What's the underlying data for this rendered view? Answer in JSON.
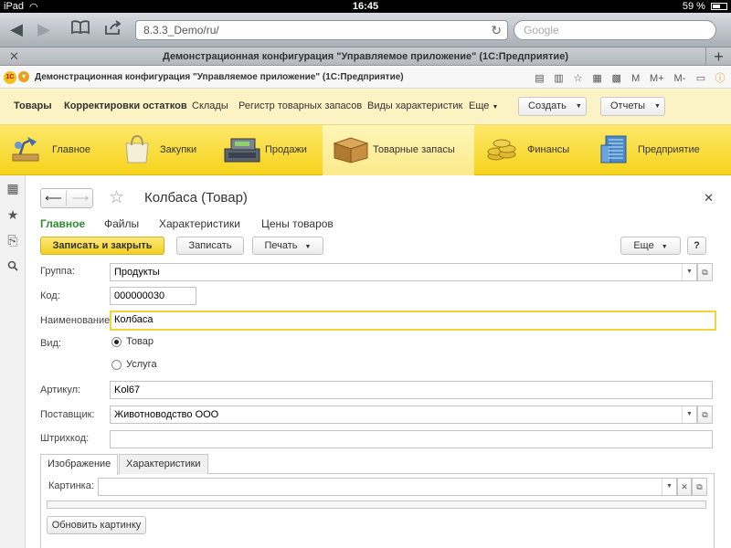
{
  "ios_status": {
    "device": "iPad",
    "time": "16:45",
    "battery": "59 %",
    "battery_level": 0.59
  },
  "browser": {
    "url": "8.3.3_Demo/ru/",
    "search_placeholder": "Google",
    "tab_title": "Демонстрационная конфигурация \"Управляемое приложение\" (1С:Предприятие)"
  },
  "app": {
    "title": "Демонстрационная конфигурация \"Управляемое приложение\"  (1С:Предприятие)",
    "toolbar_letters": {
      "m": "M",
      "m_plus": "M+",
      "m_minus": "M-"
    }
  },
  "section_menu": {
    "items": [
      "Товары",
      "Корректировки остатков",
      "Склады",
      "Регистр товарных запасов",
      "Виды характеристик"
    ],
    "more_label": "Еще",
    "create_label": "Создать",
    "reports_label": "Отчеты"
  },
  "sections": [
    {
      "label": "Главное",
      "icon": "desk-lamp-icon"
    },
    {
      "label": "Закупки",
      "icon": "shopping-bag-icon"
    },
    {
      "label": "Продажи",
      "icon": "cash-register-icon"
    },
    {
      "label": "Товарные запасы",
      "icon": "box-icon",
      "active": true
    },
    {
      "label": "Финансы",
      "icon": "coins-icon"
    },
    {
      "label": "Предприятие",
      "icon": "building-icon"
    }
  ],
  "form": {
    "title": "Колбаса (Товар)",
    "tabs": [
      "Главное",
      "Файлы",
      "Характеристики",
      "Цены товаров"
    ],
    "buttons": {
      "save_close": "Записать и закрыть",
      "save": "Записать",
      "print": "Печать",
      "more": "Еще",
      "help": "?"
    },
    "fields": {
      "group_label": "Группа:",
      "group_value": "Продукты",
      "code_label": "Код:",
      "code_value": "000000030",
      "name_label": "Наименование:",
      "name_value": "Колбаса",
      "kind_label": "Вид:",
      "kind_option_goods": "Товар",
      "kind_option_service": "Услуга",
      "article_label": "Артикул:",
      "article_value": "Kol67",
      "supplier_label": "Поставщик:",
      "supplier_value": "Животноводство ООО",
      "barcode_label": "Штрихкод:",
      "barcode_value": ""
    },
    "panel_tabs": [
      "Изображение",
      "Характеристики"
    ],
    "picture_label": "Картинка:",
    "picture_value": "",
    "refresh_picture": "Обновить картинку"
  }
}
